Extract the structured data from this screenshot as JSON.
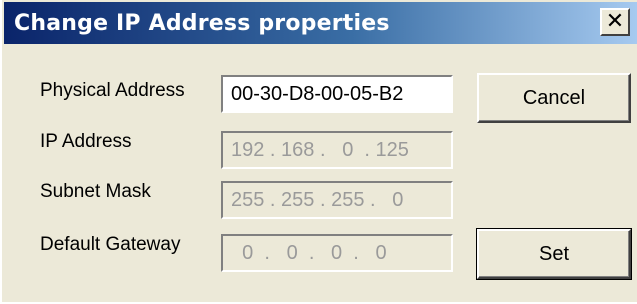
{
  "window": {
    "title": "Change IP Address properties",
    "close_glyph": "✕"
  },
  "fields": {
    "physical_address": {
      "label": "Physical Address",
      "value": "00-30-D8-00-05-B2"
    },
    "ip_address": {
      "label": "IP Address",
      "value": "192 . 168 .   0  . 125"
    },
    "subnet_mask": {
      "label": "Subnet Mask",
      "value": "255 . 255 . 255 .   0"
    },
    "default_gateway": {
      "label": "Default Gateway",
      "value": "  0  .   0  .   0  .   0"
    }
  },
  "buttons": {
    "cancel": "Cancel",
    "set": "Set"
  },
  "colors": {
    "titlebar_start": "#0a246a",
    "titlebar_end": "#a6caf0",
    "dialog_bg": "#ece9d8",
    "disabled_text": "#9a9a9a"
  }
}
